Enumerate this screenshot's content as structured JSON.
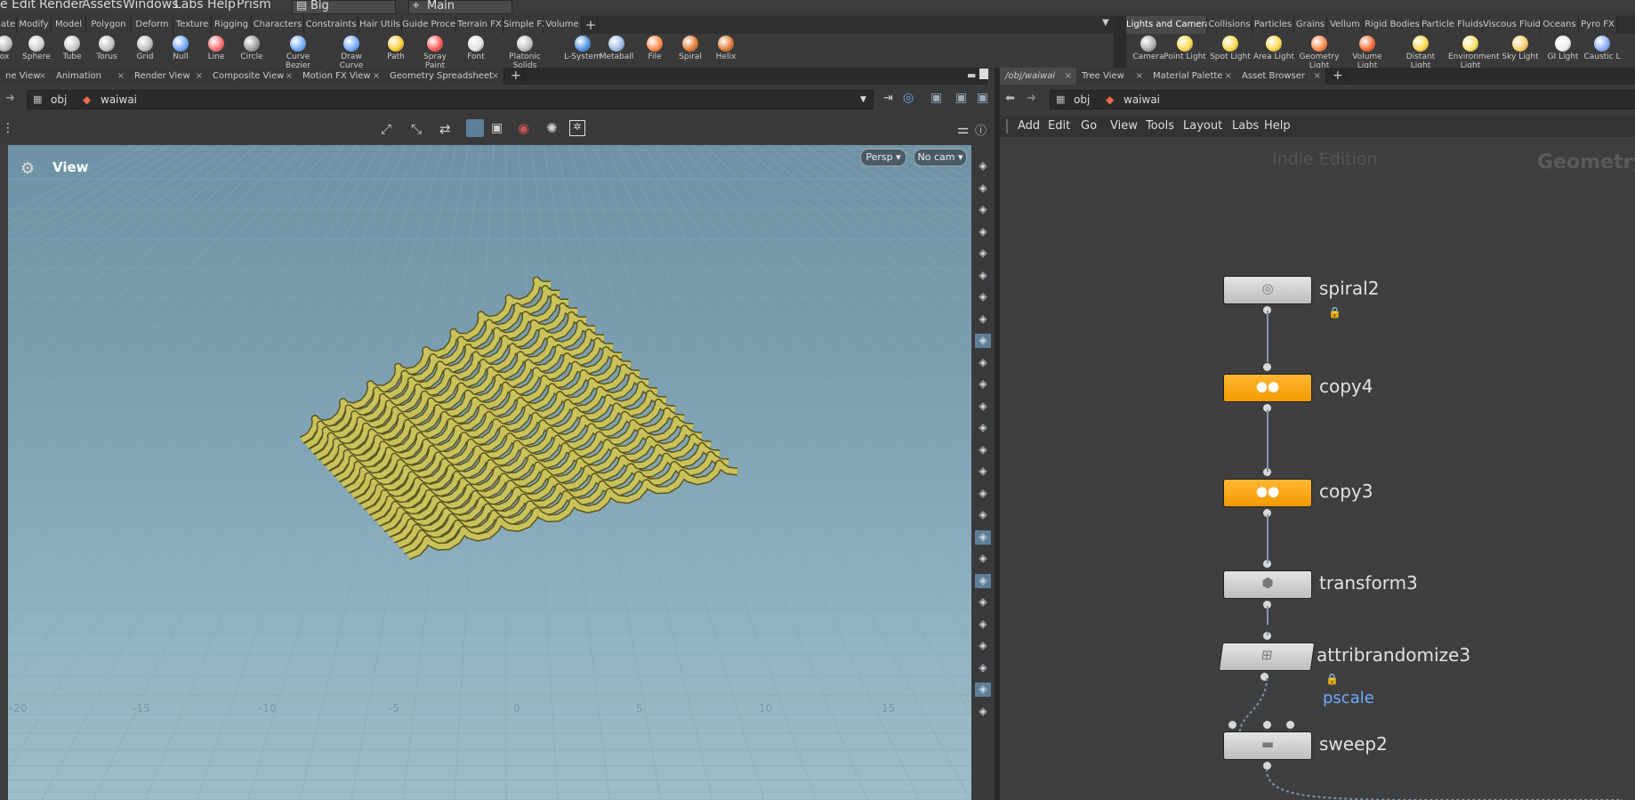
{
  "menubar": {
    "items": [
      "e",
      "Edit",
      "Render",
      "Assets",
      "Windows",
      "Labs",
      "Help",
      "Prism"
    ],
    "desktop": "Big",
    "context": "Main"
  },
  "shelf_left": {
    "tabs": [
      "ate",
      "Modify",
      "Model",
      "Polygon",
      "Deform",
      "Texture",
      "Rigging",
      "Characters",
      "Constraints",
      "Hair Utils",
      "Guide Process",
      "Terrain FX",
      "Simple FX",
      "Volume"
    ],
    "add": "+",
    "tools": [
      {
        "label": "ox",
        "icon": "box-icon",
        "color": "#bbbbbb"
      },
      {
        "label": "Sphere",
        "icon": "sphere-icon",
        "color": "#d0d0d0"
      },
      {
        "label": "Tube",
        "icon": "tube-icon",
        "color": "#c8c8c8"
      },
      {
        "label": "Torus",
        "icon": "torus-icon",
        "color": "#c0c0c0"
      },
      {
        "label": "Grid",
        "icon": "grid-icon",
        "color": "#bbbbbb"
      },
      {
        "label": "Null",
        "icon": "null-icon",
        "color": "#6fa8ff"
      },
      {
        "label": "Line",
        "icon": "line-icon",
        "color": "#ff6b6b"
      },
      {
        "label": "Circle",
        "icon": "circle-icon",
        "color": "#9a9a9a"
      },
      {
        "label": "Curve Bezier",
        "icon": "curve-bezier-icon",
        "color": "#6fa8ff"
      },
      {
        "label": "Draw Curve",
        "icon": "draw-curve-icon",
        "color": "#6fa8ff"
      },
      {
        "label": "Path",
        "icon": "path-icon",
        "color": "#ffcc33"
      },
      {
        "label": "Spray Paint",
        "icon": "spray-paint-icon",
        "color": "#ff5555"
      },
      {
        "label": "Font",
        "icon": "font-icon",
        "color": "#e0e0e0"
      },
      {
        "label": "Platonic Solids",
        "icon": "platonic-solids-icon",
        "color": "#c0c0c0"
      },
      {
        "label": "L-System",
        "icon": "l-system-icon",
        "color": "#4a90e2"
      },
      {
        "label": "Metaball",
        "icon": "metaball-icon",
        "color": "#9ab8e0"
      },
      {
        "label": "File",
        "icon": "file-icon",
        "color": "#ff8844"
      },
      {
        "label": "Spiral",
        "icon": "spiral-icon",
        "color": "#e07830"
      },
      {
        "label": "Helix",
        "icon": "helix-icon",
        "color": "#e07830"
      }
    ]
  },
  "shelf_right": {
    "tabs": [
      "Lights and Cameras",
      "Collisions",
      "Particles",
      "Grains",
      "Vellum",
      "Rigid Bodies",
      "Particle Fluids",
      "Viscous Fluids",
      "Oceans",
      "Pyro FX"
    ],
    "tools": [
      {
        "label": "Camera",
        "icon": "camera-icon",
        "color": "#aaaaaa"
      },
      {
        "label": "Point Light",
        "icon": "point-light-icon",
        "color": "#ffd84a"
      },
      {
        "label": "Spot Light",
        "icon": "spot-light-icon",
        "color": "#ffd84a"
      },
      {
        "label": "Area Light",
        "icon": "area-light-icon",
        "color": "#ffd84a"
      },
      {
        "label": "Geometry Light",
        "icon": "geometry-light-icon",
        "color": "#ff8844"
      },
      {
        "label": "Volume Light",
        "icon": "volume-light-icon",
        "color": "#ff6633"
      },
      {
        "label": "Distant Light",
        "icon": "distant-light-icon",
        "color": "#ffd84a"
      },
      {
        "label": "Environment Light",
        "icon": "environment-light-icon",
        "color": "#ffe066"
      },
      {
        "label": "Sky Light",
        "icon": "sky-light-icon",
        "color": "#ffcc66"
      },
      {
        "label": "GI Light",
        "icon": "gi-light-icon",
        "color": "#eeeeee"
      },
      {
        "label": "Caustic L",
        "icon": "caustic-light-icon",
        "color": "#88aaff"
      }
    ]
  },
  "left_pane": {
    "tabs": [
      "ne View",
      "Animation Editor",
      "Render View",
      "Composite View",
      "Motion FX View",
      "Geometry Spreadsheet"
    ],
    "close": "×",
    "add": "+",
    "path": [
      "obj",
      "waiwai"
    ]
  },
  "viewport": {
    "title": "View",
    "persp_label": "Persp ▾",
    "cam_label": "No cam ▾",
    "ticks": [
      "-20",
      "-15",
      "-10",
      "-5",
      "0",
      "5",
      "10",
      "15"
    ],
    "accent": "#c9c25a"
  },
  "right_pane": {
    "tabs": [
      "/obj/waiwai",
      "Tree View",
      "Material Palette",
      "Asset Browser"
    ],
    "close": "×",
    "add": "+",
    "path": [
      "obj",
      "waiwai"
    ],
    "menu": [
      "Add",
      "Edit",
      "Go",
      "View",
      "Tools",
      "Layout",
      "Labs",
      "Help"
    ],
    "watermark": "Indie Edition",
    "context_label": "Geometry"
  },
  "network": {
    "nodes": [
      {
        "name": "spiral2",
        "style": "gray",
        "icon": "spiral-icon",
        "locked": true
      },
      {
        "name": "copy4",
        "style": "orange",
        "icon": "copy-icon",
        "locked": false
      },
      {
        "name": "copy3",
        "style": "orange",
        "icon": "copy-icon",
        "locked": false
      },
      {
        "name": "transform3",
        "style": "gray",
        "icon": "transform-icon",
        "locked": false
      },
      {
        "name": "attribrandomize3",
        "style": "gray",
        "icon": "attribrandomize-icon",
        "locked": true
      },
      {
        "name": "sweep2",
        "style": "gray",
        "icon": "sweep-icon",
        "locked": false
      }
    ],
    "attr_label": "pscale",
    "orange": "#f7a51b",
    "wire_color": "#7e96b0"
  }
}
